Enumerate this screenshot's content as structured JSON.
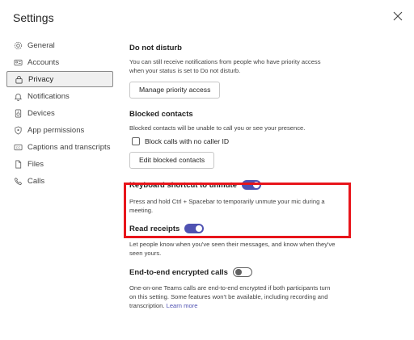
{
  "dialog": {
    "title": "Settings"
  },
  "sidebar": {
    "items": [
      {
        "label": "General",
        "icon": "gear-icon"
      },
      {
        "label": "Accounts",
        "icon": "id-card-icon"
      },
      {
        "label": "Privacy",
        "icon": "lock-icon",
        "active": true
      },
      {
        "label": "Notifications",
        "icon": "bell-icon"
      },
      {
        "label": "Devices",
        "icon": "speaker-icon"
      },
      {
        "label": "App permissions",
        "icon": "shield-icon"
      },
      {
        "label": "Captions and transcripts",
        "icon": "cc-icon"
      },
      {
        "label": "Files",
        "icon": "file-icon"
      },
      {
        "label": "Calls",
        "icon": "phone-icon"
      }
    ]
  },
  "main": {
    "dnd": {
      "title": "Do not disturb",
      "desc_line1": "You can still receive notifications from people who have priority access",
      "desc_line2": "when your status is set to Do not disturb.",
      "button": "Manage priority access"
    },
    "blocked": {
      "title": "Blocked contacts",
      "desc": "Blocked contacts will be unable to call you or see your presence.",
      "checkbox_label": "Block calls with no caller ID",
      "checkbox_checked": false,
      "button": "Edit blocked contacts"
    },
    "shortcut": {
      "title": "Keyboard shortcut to unmute",
      "toggle_on": true,
      "desc_line1": "Press and hold Ctrl + Spacebar to temporarily unmute your mic during a",
      "desc_line2": "meeting."
    },
    "receipts": {
      "title": "Read receipts",
      "toggle_on": true,
      "desc_line1": "Let people know when you've seen their messages, and know when they've",
      "desc_line2": "seen yours."
    },
    "e2e": {
      "title": "End-to-end encrypted calls",
      "toggle_on": false,
      "desc_line1": "One-on-one Teams calls are end-to-end encrypted if both participants turn",
      "desc_line2": "on this setting. Some features won't be available, including recording and",
      "desc_line3": "transcription.",
      "link": "Learn more"
    }
  },
  "colors": {
    "accent": "#4f52b2",
    "highlight": "#e8151b"
  }
}
